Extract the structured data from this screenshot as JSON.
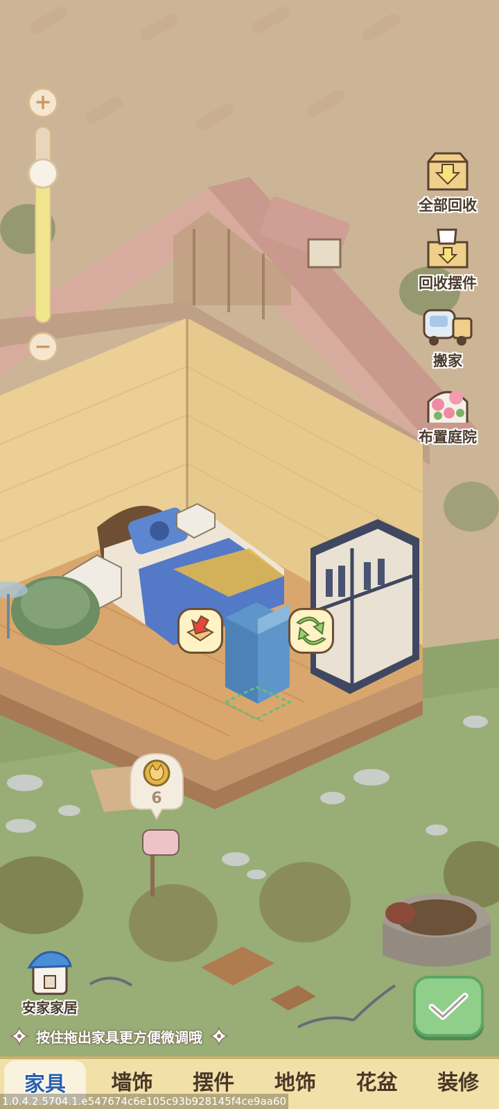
{
  "zoom": {
    "plus_symbol": "+",
    "minus_symbol": "−",
    "level": 0.76
  },
  "tools": {
    "recycle_all": "全部回收",
    "recycle_decor": "回收摆件",
    "move_house": "搬家",
    "arrange_yard": "布置庭院"
  },
  "home": {
    "label": "安家家居"
  },
  "hint": {
    "text": "按住拖出家具更方便微调哦"
  },
  "coin_badge": {
    "count": "6"
  },
  "tabs": [
    {
      "label": "家具",
      "active": true
    },
    {
      "label": "墙饰",
      "active": false
    },
    {
      "label": "摆件",
      "active": false
    },
    {
      "label": "地饰",
      "active": false
    },
    {
      "label": "花盆",
      "active": false
    },
    {
      "label": "装修",
      "active": false
    }
  ],
  "version": "1.0.4.2.5704.1.e547674c6e105c93b928145f4ce9aa60",
  "colors": {
    "confirm": "#8fcf8a",
    "tab_bar": "#f2e0a9",
    "active_tab_text": "#2d5fa8"
  },
  "icons": [
    "plus-icon",
    "minus-icon",
    "box-recycle-icon",
    "cup-recycle-icon",
    "truck-icon",
    "flower-icon",
    "home-icon",
    "check-icon",
    "store-icon",
    "rotate-icon",
    "cat-coin-icon",
    "sparkle-icon"
  ]
}
